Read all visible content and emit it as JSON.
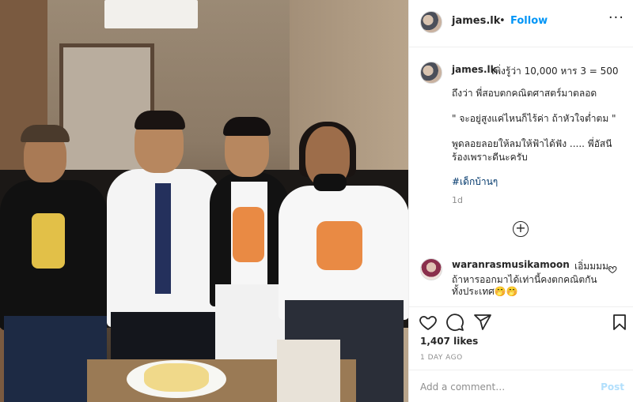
{
  "post": {
    "photo_alt": "Four men sitting on a black sofa"
  },
  "header": {
    "username": "james.lk",
    "separator": "•",
    "follow_label": "Follow",
    "more_label": "···"
  },
  "caption": {
    "username": "james.lk",
    "line1": "เพิ่งรู้ว่า 10,000 หาร 3 = 500",
    "line2": "ถึงว่า พี่สอบตกคณิตศาสตร์มาตลอด",
    "line3": "\" จะอยู่สูงแค่ไหนก็ไร้ค่า ถ้าหัวใจต่ำตม \"",
    "line4": "พูดลอยลอยให้ลมให้ฟ้าได้ฟัง ..... พี่อัสนี",
    "line5": "ร้องเพราะดีนะครับ",
    "hashtag": "#เด็กบ้านๆ",
    "age": "1d"
  },
  "load_more": {
    "label": "+"
  },
  "comment": {
    "username": "waranrasmusikamoon",
    "text1": "เอิ่มมมม..",
    "text2": "ถ้าหารออกมาได้เท่านี้คงตกคณิตกัน",
    "text3": "ทั้งประเทศ🤭🤭"
  },
  "actions": {
    "likes": "1,407 likes",
    "time": "1 DAY AGO"
  },
  "comment_box": {
    "placeholder": "Add a comment…",
    "post_label": "Post"
  },
  "icons": {
    "heart": "heart-icon",
    "comment": "comment-icon",
    "share": "share-icon",
    "save": "bookmark-icon"
  },
  "colors": {
    "accent": "#0095f6",
    "post_disabled": "#b2dffc",
    "secondary_text": "#8e8e8e",
    "hashtag": "#00376b"
  }
}
